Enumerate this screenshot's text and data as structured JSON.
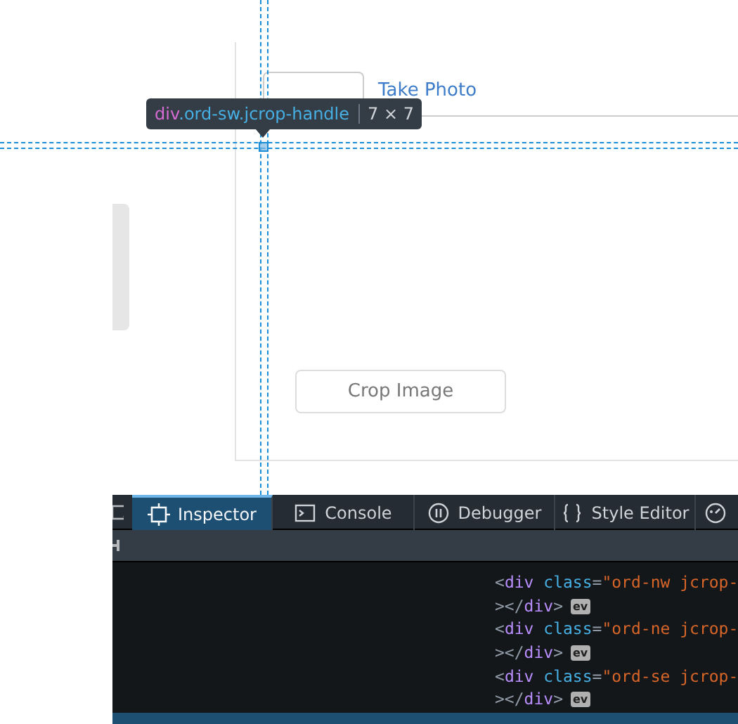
{
  "page": {
    "upload_tab_selected": true,
    "take_photo_link": "Take Photo",
    "crop_button": "Crop Image"
  },
  "highlight": {
    "tooltip_tag": "div",
    "tooltip_selector": ".ord-sw.jcrop-handle",
    "tooltip_size": "7 × 7"
  },
  "devtools": {
    "tabs": [
      {
        "label": "Inspector",
        "selected": true
      },
      {
        "label": "Console",
        "selected": false
      },
      {
        "label": "Debugger",
        "selected": false
      },
      {
        "label": "Style Editor",
        "selected": false
      }
    ],
    "markup_lines": [
      {
        "tokens": [
          {
            "kind": "punct",
            "text": "<"
          },
          {
            "kind": "tag",
            "text": "div"
          },
          {
            "kind": "attr",
            "text": " class"
          },
          {
            "kind": "punct",
            "text": "="
          },
          {
            "kind": "string",
            "text": "\"ord-nw jcrop-"
          }
        ]
      },
      {
        "tokens": [
          {
            "kind": "punct",
            "text": "></"
          },
          {
            "kind": "tag",
            "text": "div"
          },
          {
            "kind": "punct",
            "text": ">"
          }
        ],
        "badge": "ev"
      },
      {
        "tokens": [
          {
            "kind": "punct",
            "text": "<"
          },
          {
            "kind": "tag",
            "text": "div"
          },
          {
            "kind": "attr",
            "text": " class"
          },
          {
            "kind": "punct",
            "text": "="
          },
          {
            "kind": "string",
            "text": "\"ord-ne jcrop-"
          }
        ]
      },
      {
        "tokens": [
          {
            "kind": "punct",
            "text": "></"
          },
          {
            "kind": "tag",
            "text": "div"
          },
          {
            "kind": "punct",
            "text": ">"
          }
        ],
        "badge": "ev"
      },
      {
        "tokens": [
          {
            "kind": "punct",
            "text": "<"
          },
          {
            "kind": "tag",
            "text": "div"
          },
          {
            "kind": "attr",
            "text": " class"
          },
          {
            "kind": "punct",
            "text": "="
          },
          {
            "kind": "string",
            "text": "\"ord-se jcrop-"
          }
        ]
      },
      {
        "tokens": [
          {
            "kind": "punct",
            "text": "></"
          },
          {
            "kind": "tag",
            "text": "div"
          },
          {
            "kind": "punct",
            "text": ">"
          }
        ],
        "badge": "ev"
      }
    ],
    "selection_bar": true
  }
}
